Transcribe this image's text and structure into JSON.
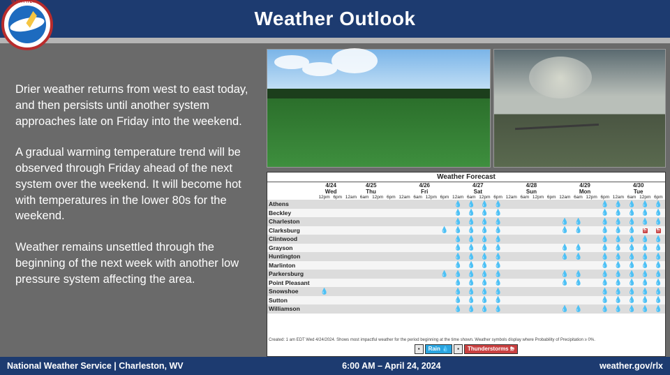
{
  "header": {
    "title": "Weather Outlook"
  },
  "summary": {
    "p1": "Drier weather returns from west to east today, and then persists until another system approaches late on Friday into the weekend.",
    "p2": "A gradual warming temperature trend will be observed through Friday ahead of the next system over the weekend. It will become hot with temperatures in the lower 80s for the weekend.",
    "p3": "Weather remains unsettled through the beginning of the next week with another low pressure system affecting the area."
  },
  "forecast": {
    "title": "Weather Forecast",
    "days": [
      {
        "date": "4/24",
        "dow": "Wed",
        "hours": [
          "12pm",
          "6pm"
        ]
      },
      {
        "date": "4/25",
        "dow": "Thu",
        "hours": [
          "12am",
          "6am",
          "12pm",
          "6pm"
        ]
      },
      {
        "date": "4/26",
        "dow": "Fri",
        "hours": [
          "12am",
          "6am",
          "12pm",
          "6pm"
        ]
      },
      {
        "date": "4/27",
        "dow": "Sat",
        "hours": [
          "12am",
          "6am",
          "12pm",
          "6pm"
        ]
      },
      {
        "date": "4/28",
        "dow": "Sun",
        "hours": [
          "12am",
          "6am",
          "12pm",
          "6pm"
        ]
      },
      {
        "date": "4/29",
        "dow": "Mon",
        "hours": [
          "12am",
          "6am",
          "12pm",
          "6pm"
        ]
      },
      {
        "date": "4/30",
        "dow": "Tue",
        "hours": [
          "12am",
          "6am",
          "12pm",
          "6pm"
        ]
      }
    ],
    "locations": [
      "Athens",
      "Beckley",
      "Charleston",
      "Clarksburg",
      "Clintwood",
      "Grayson",
      "Huntington",
      "Marlinton",
      "Parkersburg",
      "Point Pleasant",
      "Snowshoe",
      "Sutton",
      "Williamson"
    ],
    "cells": {
      "Athens": [
        "",
        "",
        "",
        "",
        "",
        "",
        "",
        "",
        "",
        "",
        "r",
        "r",
        "r",
        "r",
        "",
        "",
        "",
        "",
        "",
        "",
        "",
        "r",
        "r",
        "r",
        "r",
        "r"
      ],
      "Beckley": [
        "",
        "",
        "",
        "",
        "",
        "",
        "",
        "",
        "",
        "",
        "r",
        "r",
        "r",
        "r",
        "",
        "",
        "",
        "",
        "",
        "",
        "",
        "r",
        "r",
        "r",
        "r",
        "r"
      ],
      "Charleston": [
        "",
        "",
        "",
        "",
        "",
        "",
        "",
        "",
        "",
        "",
        "r",
        "r",
        "r",
        "r",
        "",
        "",
        "",
        "",
        "r",
        "r",
        "",
        "r",
        "r",
        "r",
        "r",
        "r"
      ],
      "Clarksburg": [
        "",
        "",
        "",
        "",
        "",
        "",
        "",
        "",
        "",
        "r",
        "r",
        "r",
        "r",
        "r",
        "",
        "",
        "",
        "",
        "r",
        "r",
        "",
        "r",
        "r",
        "r",
        "t",
        "t"
      ],
      "Clintwood": [
        "",
        "",
        "",
        "",
        "",
        "",
        "",
        "",
        "",
        "",
        "r",
        "r",
        "r",
        "r",
        "",
        "",
        "",
        "",
        "",
        "",
        "",
        "r",
        "r",
        "r",
        "r",
        "r"
      ],
      "Grayson": [
        "",
        "",
        "",
        "",
        "",
        "",
        "",
        "",
        "",
        "",
        "r",
        "r",
        "r",
        "r",
        "",
        "",
        "",
        "",
        "r",
        "r",
        "",
        "r",
        "r",
        "r",
        "r",
        "r"
      ],
      "Huntington": [
        "",
        "",
        "",
        "",
        "",
        "",
        "",
        "",
        "",
        "",
        "r",
        "r",
        "r",
        "r",
        "",
        "",
        "",
        "",
        "r",
        "r",
        "",
        "r",
        "r",
        "r",
        "r",
        "r"
      ],
      "Marlinton": [
        "",
        "",
        "",
        "",
        "",
        "",
        "",
        "",
        "",
        "",
        "r",
        "r",
        "r",
        "r",
        "",
        "",
        "",
        "",
        "",
        "",
        "",
        "r",
        "r",
        "r",
        "r",
        "r"
      ],
      "Parkersburg": [
        "",
        "",
        "",
        "",
        "",
        "",
        "",
        "",
        "",
        "r",
        "r",
        "r",
        "r",
        "r",
        "",
        "",
        "",
        "",
        "r",
        "r",
        "",
        "r",
        "r",
        "r",
        "r",
        "r"
      ],
      "Point Pleasant": [
        "",
        "",
        "",
        "",
        "",
        "",
        "",
        "",
        "",
        "",
        "r",
        "r",
        "r",
        "r",
        "",
        "",
        "",
        "",
        "r",
        "r",
        "",
        "r",
        "r",
        "r",
        "r",
        "r"
      ],
      "Snowshoe": [
        "r",
        "",
        "",
        "",
        "",
        "",
        "",
        "",
        "",
        "",
        "r",
        "r",
        "r",
        "r",
        "",
        "",
        "",
        "",
        "",
        "",
        "",
        "r",
        "r",
        "r",
        "r",
        "r"
      ],
      "Sutton": [
        "",
        "",
        "",
        "",
        "",
        "",
        "",
        "",
        "",
        "",
        "r",
        "r",
        "r",
        "r",
        "",
        "",
        "",
        "",
        "",
        "",
        "",
        "r",
        "r",
        "r",
        "r",
        "r"
      ],
      "Williamson": [
        "",
        "",
        "",
        "",
        "",
        "",
        "",
        "",
        "",
        "",
        "r",
        "r",
        "r",
        "r",
        "",
        "",
        "",
        "",
        "r",
        "r",
        "",
        "r",
        "r",
        "r",
        "r",
        "r"
      ]
    },
    "legend": {
      "rain": "Rain",
      "ts": "Thunderstorms"
    },
    "note": "Created: 1 am EDT Wed 4/24/2024. Shows most impactful weather for the period beginning at the time shown. Weather symbols display where Probability of Precipitation ≥ 0%."
  },
  "footer": {
    "left": "National Weather Service | Charleston, WV",
    "center": "6:00 AM – April 24, 2024",
    "right": "weather.gov/rlx"
  }
}
